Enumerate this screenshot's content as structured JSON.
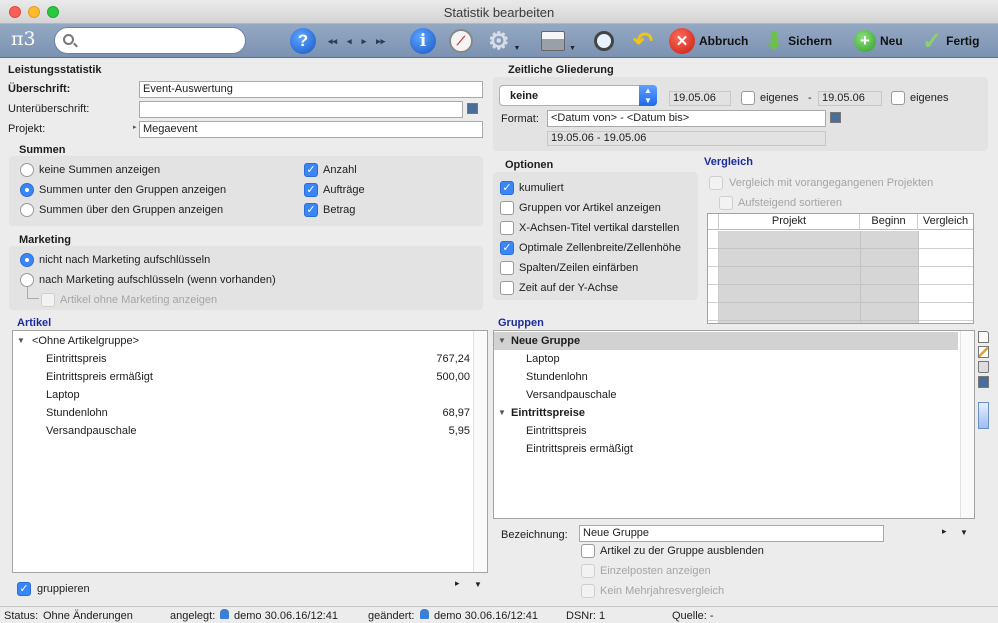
{
  "window": {
    "title": "Statistik bearbeiten"
  },
  "toolbar": {
    "logo": "π3",
    "search_placeholder": "",
    "abbruch_label": "Abbruch",
    "sichern_label": "Sichern",
    "neu_label": "Neu",
    "fertig_label": "Fertig"
  },
  "leistung": {
    "heading": "Leistungsstatistik",
    "ueberschrift_label": "Überschrift:",
    "ueberschrift_value": "Event-Auswertung",
    "unterueberschrift_label": "Unterüberschrift:",
    "unterueberschrift_value": "",
    "projekt_label": "Projekt:",
    "projekt_value": "Megaevent"
  },
  "summen": {
    "heading": "Summen",
    "opt1": "keine Summen anzeigen",
    "opt2": "Summen unter den Gruppen anzeigen",
    "opt3": "Summen über den Gruppen anzeigen",
    "cb1": "Anzahl",
    "cb2": "Aufträge",
    "cb3": "Betrag"
  },
  "marketing": {
    "heading": "Marketing",
    "opt1": "nicht nach Marketing aufschlüsseln",
    "opt2": "nach Marketing aufschlüsseln (wenn vorhanden)",
    "cb1": "Artikel ohne Marketing anzeigen"
  },
  "artikel": {
    "heading": "Artikel",
    "group": "<Ohne Artikelgruppe>",
    "items": [
      {
        "name": "Eintrittspreis",
        "value": "767,24"
      },
      {
        "name": "Eintrittspreis ermäßigt",
        "value": "500,00"
      },
      {
        "name": "Laptop",
        "value": ""
      },
      {
        "name": "Stundenlohn",
        "value": "68,97"
      },
      {
        "name": "Versandpauschale",
        "value": "5,95"
      }
    ],
    "gruppieren_label": "gruppieren"
  },
  "zeit": {
    "heading": "Zeitliche Gliederung",
    "select_value": "keine",
    "date_from": "19.05.06",
    "eigenes1": "eigenes",
    "dash": "-",
    "date_to": "19.05.06",
    "eigenes2": "eigenes",
    "format_label": "Format:",
    "format_value": "<Datum von> - <Datum bis>",
    "format_preview": "19.05.06 - 19.05.06"
  },
  "optionen": {
    "heading": "Optionen",
    "items": [
      "kumuliert",
      "Gruppen vor Artikel anzeigen",
      "X-Achsen-Titel vertikal darstellen",
      "Optimale Zellenbreite/Zellenhöhe",
      "Spalten/Zeilen einfärben",
      "Zeit auf der Y-Achse"
    ]
  },
  "vergleich": {
    "heading": "Vergleich",
    "cb1": "Vergleich mit vorangegangenen Projekten",
    "cb2": "Aufsteigend sortieren",
    "col_projekt": "Projekt",
    "col_beginn": "Beginn",
    "col_vergleich": "Vergleich"
  },
  "gruppen": {
    "heading": "Gruppen",
    "group1": "Neue Gruppe",
    "group1_items": [
      "Laptop",
      "Stundenlohn",
      "Versandpauschale"
    ],
    "group2": "Eintrittspreise",
    "group2_items": [
      "Eintrittspreis",
      "Eintrittspreis ermäßigt"
    ],
    "bezeichnung_label": "Bezeichnung:",
    "bezeichnung_value": "Neue Gruppe",
    "cb1": "Artikel zu der Gruppe ausblenden",
    "cb2": "Einzelposten anzeigen",
    "cb3": "Kein Mehrjahresvergleich"
  },
  "status": {
    "status_label": "Status:",
    "status_value": "Ohne Änderungen",
    "angelegt_label": "angelegt:",
    "angelegt_value": "demo 30.06.16/12:41",
    "geaendert_label": "geändert:",
    "geaendert_value": "demo 30.06.16/12:41",
    "dsnr": "DSNr: 1",
    "quelle": "Quelle: -"
  },
  "colors": {
    "accent": "#3b86f7",
    "toolbar": "#8aa0bd",
    "heading_blue": "#1a2d9c"
  }
}
